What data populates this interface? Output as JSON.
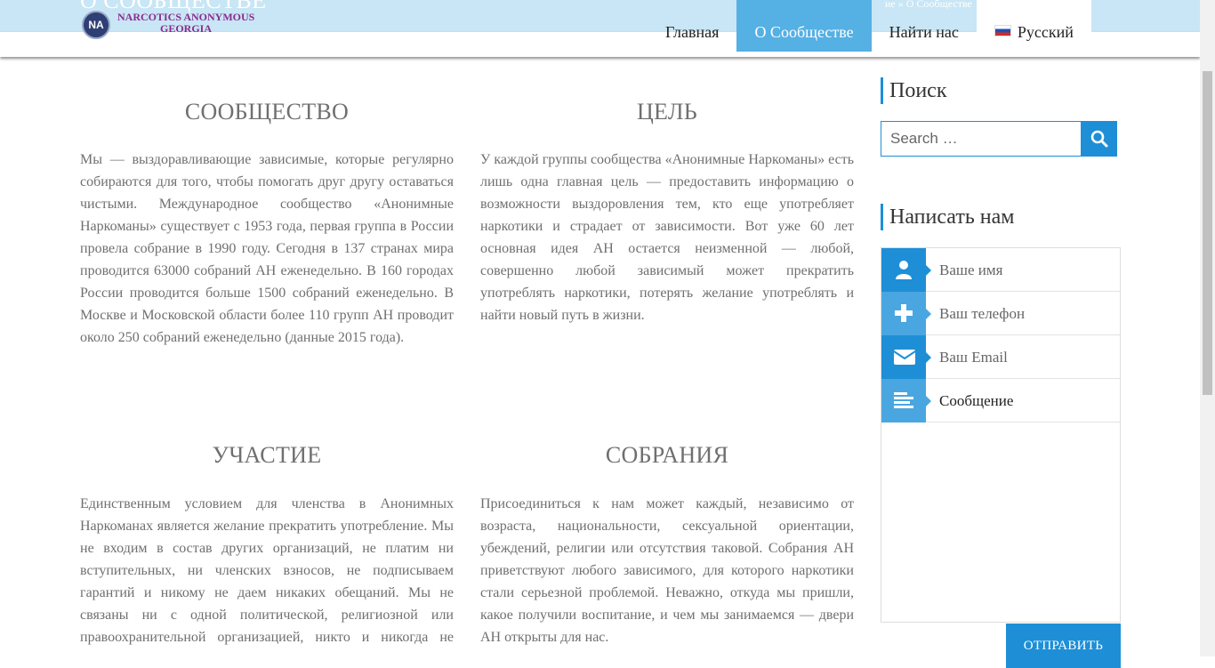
{
  "page": {
    "title": "О СООБЩЕСТВЕ",
    "breadcrumb": "ие » О Сообществе"
  },
  "logo": {
    "emblem": "NA",
    "line1": "NARCOTICS ANONYMOUS",
    "line2": "GEORGIA"
  },
  "nav": {
    "items": [
      {
        "label": "Главная"
      },
      {
        "label": "О Сообществе"
      },
      {
        "label": "Найти нас"
      },
      {
        "label": "Русский"
      }
    ]
  },
  "sections": [
    {
      "heading": "СООБЩЕСТВО",
      "text": "Мы — выздоравливающие зависимые, которые регулярно собираются для того, чтобы помогать друг другу оставаться чистыми. Международное сообщество «Анонимные Наркоманы» существует с 1953 года, первая группа в России провела собрание в 1990 году. Сегодня в 137 странах мира проводится 63000 собраний АН еженедельно. В 160 городах России проводится больше 1500 собраний еженедельно. В Москве и Московской области более 110 групп АН проводит около 250 собраний еженедельно (данные 2015 года)."
    },
    {
      "heading": "ЦЕЛЬ",
      "text": "У каждой группы сообщества «Анонимные Наркоманы» есть лишь одна главная цель — предоставить информацию о возможности выздоровления тем, кто еще употребляет наркотики и страдает от зависимости. Вот уже 60 лет основная идея АН остается неизменной — любой, совершенно любой зависимый может прекратить употреблять наркотики, потерять желание употреблять и найти новый путь в жизни."
    },
    {
      "heading": "УЧАСТИЕ",
      "text": "Единственным условием для членства в Анонимных Наркоманах является желание прекратить употребление. Мы не входим в состав других организаций, не платим ни вступительных, ни членских взносов, не подписываем гарантий и никому не даем никаких обещаний. Мы не связаны ни с одной политической, религиозной или правоохранительной организацией, никто и никогда не осуществляет за"
    },
    {
      "heading": "СОБРАНИЯ",
      "text": "Присоединиться к нам может каждый, независимо от возраста, национальности, сексуальной ориентации, убеждений, религии или отсутствия таковой. Собрания АН приветствуют любого зависимого, для которого наркотики стали серьезной проблемой. Неважно, откуда мы пришли, какое получили воспитание, и чем мы занимаемся — двери АН открыты для нас."
    }
  ],
  "sidebar": {
    "search_title": "Поиск",
    "search_placeholder": "Search …",
    "contact_title": "Написать нам",
    "fields": [
      {
        "label": "Ваше имя",
        "icon": "user-icon"
      },
      {
        "label": "Ваш телефон",
        "icon": "plus-icon"
      },
      {
        "label": "Ваш Email",
        "icon": "envelope-icon"
      },
      {
        "label": "Сообщение",
        "icon": "align-left-icon"
      }
    ],
    "submit_label": "ОТПРАВИТЬ"
  },
  "colors": {
    "accent": "#1e8fd6",
    "nav_active": "#55b0e3",
    "title_band": "#c8e6f5",
    "logo_text": "#8b2b8f"
  }
}
